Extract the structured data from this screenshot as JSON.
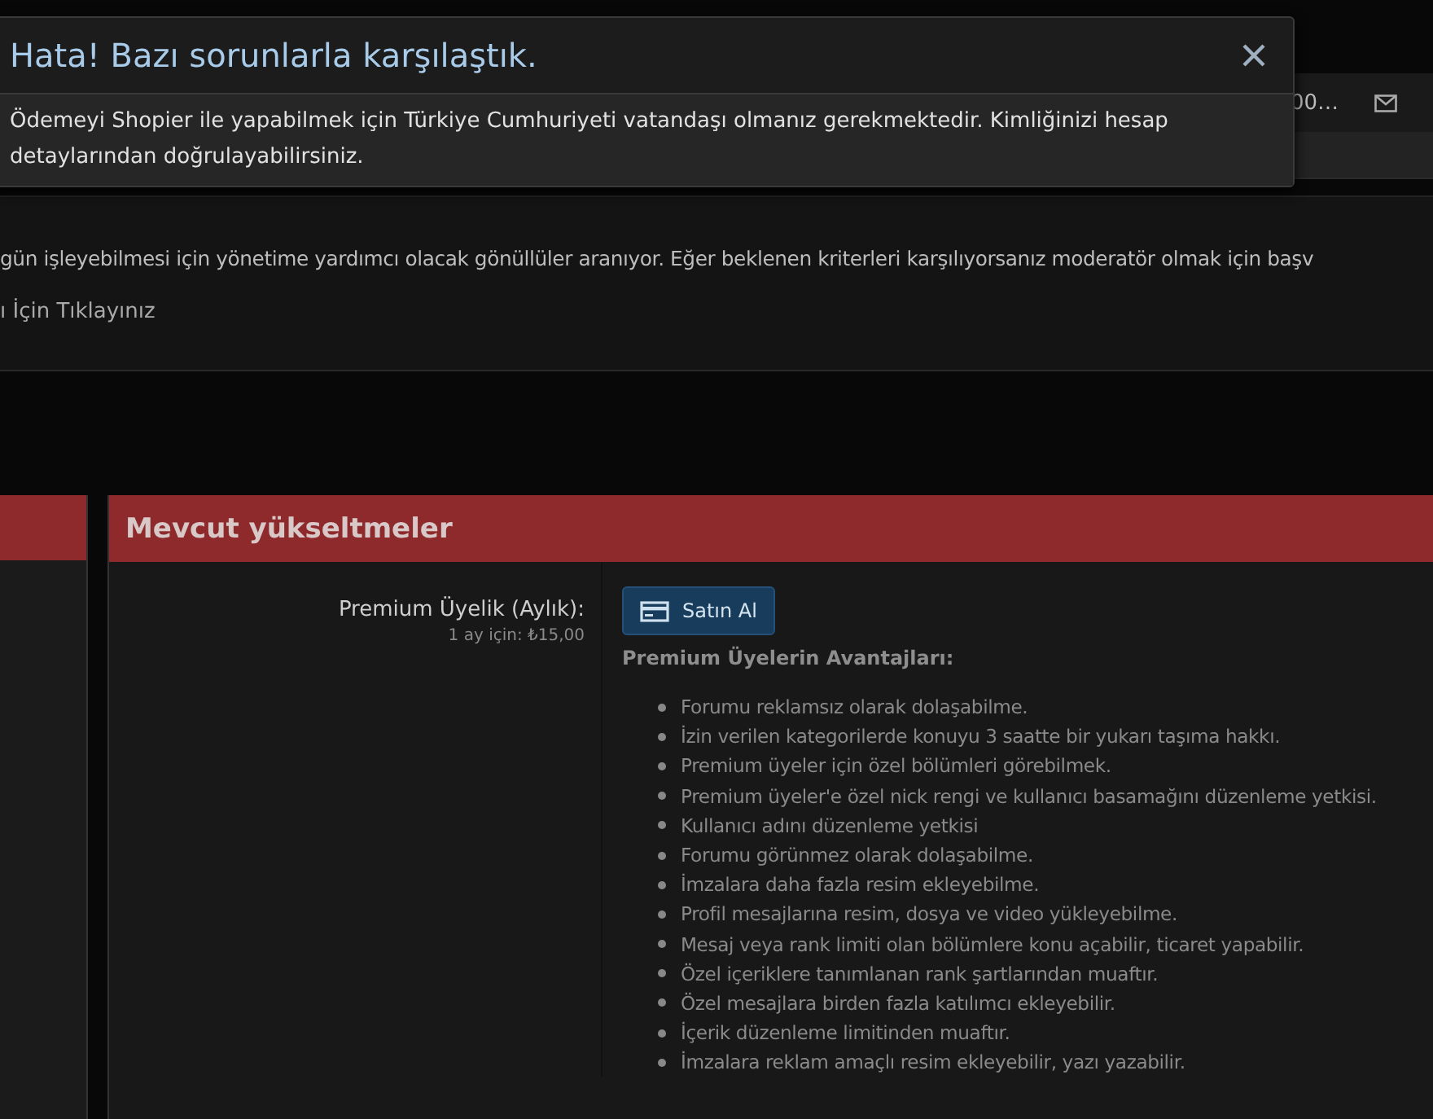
{
  "header": {
    "truncated_text": "00…"
  },
  "notice": {
    "text": "gün işleyebilmesi için yönetime yardımcı olacak gönüllüler aranıyor. Eğer beklenen kriterleri karşılıyorsanız moderatör olmak için başv",
    "link": "ı İçin Tıklayınız"
  },
  "upgrades": {
    "title": "Mevcut yükseltmeler",
    "items": [
      {
        "label": "Premium Üyelik (Aylık):",
        "price": "1 ay için: ₺15,00",
        "button": "Satın Al",
        "benefits_title": "Premium Üyelerin Avantajları:",
        "benefits": [
          "Forumu reklamsız olarak dolaşabilme.",
          "İzin verilen kategorilerde konuyu 3 saatte bir yukarı taşıma hakkı.",
          "Premium üyeler için özel bölümleri görebilmek.",
          "Premium üyeler'e özel nick rengi ve kullanıcı basamağını düzenleme yetkisi.",
          "Kullanıcı adını düzenleme yetkisi",
          "Forumu görünmez olarak dolaşabilme.",
          "İmzalara daha fazla resim ekleyebilme.",
          "Profil mesajlarına resim, dosya ve video yükleyebilme.",
          "Mesaj veya rank limiti olan bölümlere konu açabilir, ticaret yapabilir.",
          "Özel içeriklere tanımlanan rank şartlarından muaftır.",
          "Özel mesajlara birden fazla katılımcı ekleyebilir.",
          "İçerik düzenleme limitinden muaftır.",
          "İmzalara reklam amaçlı resim ekleyebilir, yazı yazabilir."
        ]
      }
    ]
  },
  "dialog": {
    "title": "Hata! Bazı sorunlarla karşılaştık.",
    "message": "Ödemeyi Shopier ile yapabilmek için Türkiye Cumhuriyeti vatandaşı olmanız gerekmektedir. Kimliğinizi hesap detaylarından doğrulayabilirsiniz."
  }
}
